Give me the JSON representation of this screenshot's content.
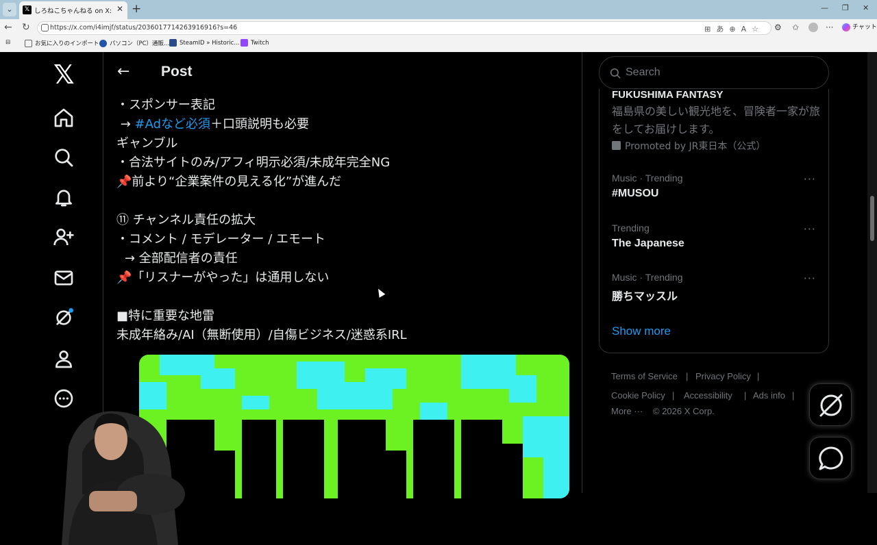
{
  "browser": {
    "tab_title": "しろねこちゃんねる on X: 『KICK/規約",
    "url": "https://x.com/i4imjf/status/2036017714263916916?s=46",
    "chat_label": "チャット",
    "bookmarks": [
      {
        "label": "お気に入りのインポート"
      },
      {
        "label": "パソコン（PC）通販..."
      },
      {
        "label": "SteamID » Historic..."
      },
      {
        "label": "Twitch"
      }
    ]
  },
  "header": {
    "title": "Post"
  },
  "tweet": {
    "lines": [
      "・スポンサー表記",
      "→ ",
      "ギャンブル",
      "・合法サイトのみ/アフィ明示必須/未成年完全NG",
      "📌前より“企業案件の見える化”が進んだ",
      "",
      "⑪ チャンネル責任の拡大",
      "・コメント / モデレーター / エモート",
      "→ 全部配信者の責任",
      "📌「リスナーがやった」は通用しない",
      "",
      "■特に重要な地雷",
      "未成年絡み/AI（無断使用）/自傷ビジネス/迷惑系IRL"
    ],
    "hashtag": "#Adなど必須",
    "line2_rest": "＋口頭説明も必要"
  },
  "search": {
    "placeholder": "Search"
  },
  "promo": {
    "title": "FUKUSHIMA FANTASY",
    "desc": "福島県の美しい観光地を、冒険者一家が旅をしてお届けします。",
    "by": "Promoted by JR東日本（公式）"
  },
  "trends": [
    {
      "meta": "Music · Trending",
      "name": "#MUSOU"
    },
    {
      "meta": "Trending",
      "name": "The Japanese"
    },
    {
      "meta": "Music · Trending",
      "name": "勝ちマッスル"
    }
  ],
  "show_more": "Show more",
  "footer": {
    "terms": "Terms of Service",
    "privacy": "Privacy Policy",
    "cookie": "Cookie Policy",
    "accessibility": "Accessibility",
    "ads": "Ads info",
    "more": "More ···",
    "copyright": "© 2026 X Corp."
  },
  "colors": {
    "accent": "#1d9bf0",
    "background": "#000000",
    "text": "#e7e9ea",
    "muted": "#71767b"
  },
  "icons": [
    "x-logo-icon",
    "home-icon",
    "search-icon",
    "bell-icon",
    "follow-icon",
    "mail-icon",
    "grok-icon",
    "profile-icon",
    "more-icon"
  ]
}
